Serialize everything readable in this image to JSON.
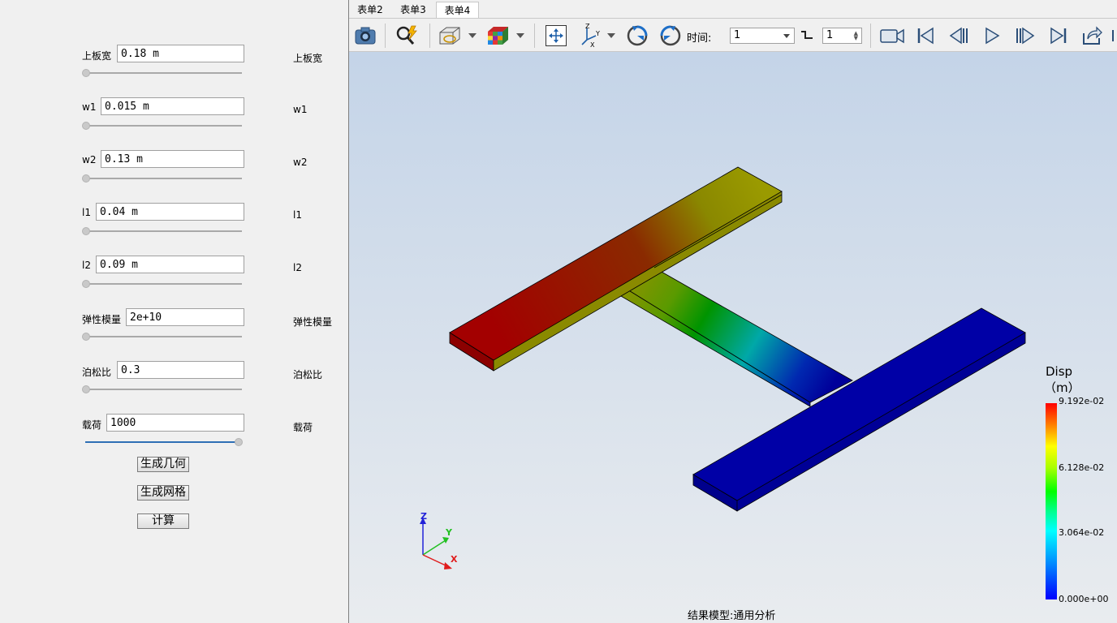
{
  "tabs": [
    {
      "label": "表单2"
    },
    {
      "label": "表单3"
    },
    {
      "label": "表单4"
    }
  ],
  "params": [
    {
      "label": "上板宽",
      "value": "0.18 m",
      "right_label": "上板宽",
      "slider_fraction": 0
    },
    {
      "label": "w1",
      "value": "0.015 m",
      "right_label": "w1",
      "slider_fraction": 0
    },
    {
      "label": "w2",
      "value": "0.13 m",
      "right_label": "w2",
      "slider_fraction": 0
    },
    {
      "label": "l1",
      "value": "0.04 m",
      "right_label": "l1",
      "slider_fraction": 0
    },
    {
      "label": "l2",
      "value": "0.09 m",
      "right_label": "l2",
      "slider_fraction": 0
    },
    {
      "label": "弹性模量",
      "value": "2e+10",
      "right_label": "弹性模量",
      "slider_fraction": 0
    },
    {
      "label": "泊松比",
      "value": "0.3",
      "right_label": "泊松比",
      "slider_fraction": 0
    },
    {
      "label": "载荷",
      "value": "1000",
      "right_label": "载荷",
      "slider_fraction": 1
    }
  ],
  "buttons": {
    "generate_geometry": "生成几何",
    "generate_mesh": "生成网格",
    "compute": "计算"
  },
  "toolbar": {
    "time_label": "时间:",
    "time_value": "1",
    "step_value": "1"
  },
  "icons": [
    "camera-icon",
    "probe-search-icon",
    "clip-view-icon",
    "color-cube-icon",
    "fit-view-icon",
    "axes-orient-icon",
    "rotate-ccw-icon",
    "rotate-cw-icon",
    "record-video-icon",
    "first-frame-icon",
    "prev-frame-icon",
    "play-icon",
    "next-frame-icon",
    "last-frame-icon",
    "export-icon"
  ],
  "viewport": {
    "status_text": "结果模型:通用分析"
  },
  "legend": {
    "title": "Disp",
    "unit": "（m）",
    "max": "9.192e-02",
    "tick2": "6.128e-02",
    "tick1": "3.064e-02",
    "min": "0.000e+00"
  },
  "axes": {
    "x": "X",
    "y": "Y",
    "z": "Z"
  },
  "colors": {
    "max_color": "#ff0000",
    "min_color": "#0000ff",
    "slider_active": "#2e6fb5"
  }
}
